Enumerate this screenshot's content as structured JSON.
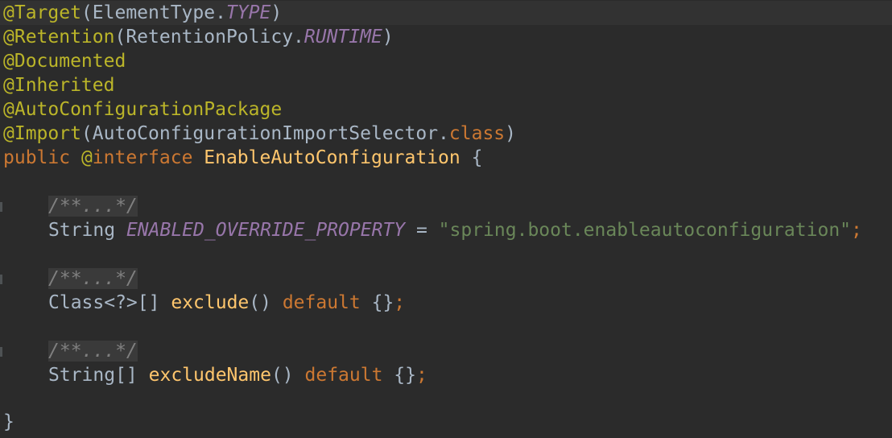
{
  "theme": {
    "background": "#2b2b2b",
    "current_line": "#323232",
    "annotation": "#bbb529",
    "keyword": "#cc7832",
    "identifier": "#a9b7c6",
    "static_field": "#9876aa",
    "method": "#ffc66d",
    "string": "#6a8759",
    "comment": "#808080"
  },
  "code": {
    "l1": {
      "anno": "@Target",
      "open": "(ElementType.",
      "field": "TYPE",
      "close": ")"
    },
    "l2": {
      "anno": "@Retention",
      "open": "(RetentionPolicy.",
      "field": "RUNTIME",
      "close": ")"
    },
    "l3": {
      "anno": "@Documented"
    },
    "l4": {
      "anno": "@Inherited"
    },
    "l5": {
      "anno": "@AutoConfigurationPackage"
    },
    "l6": {
      "anno": "@Import",
      "open": "(AutoConfigurationImportSelector.",
      "kw": "class",
      "close": ")"
    },
    "l7": {
      "kw1": "public",
      "at": " @",
      "kw2": "interface",
      "name": " EnableAutoConfiguration",
      "brace": " {"
    },
    "fold": "/**...*/",
    "l9": {
      "type": "String ",
      "field": "ENABLED_OVERRIDE_PROPERTY",
      "eq": " = ",
      "str": "\"spring.boot.enableautoconfiguration\"",
      "semi": ";"
    },
    "l11": {
      "type": "Class<?>[] ",
      "method": "exclude",
      "parens": "() ",
      "kw": "default",
      "rest": " {}",
      "semi": ";"
    },
    "l13": {
      "type": "String[] ",
      "method": "excludeName",
      "parens": "() ",
      "kw": "default",
      "rest": " {}",
      "semi": ";"
    },
    "l14": {
      "close": "}"
    }
  }
}
